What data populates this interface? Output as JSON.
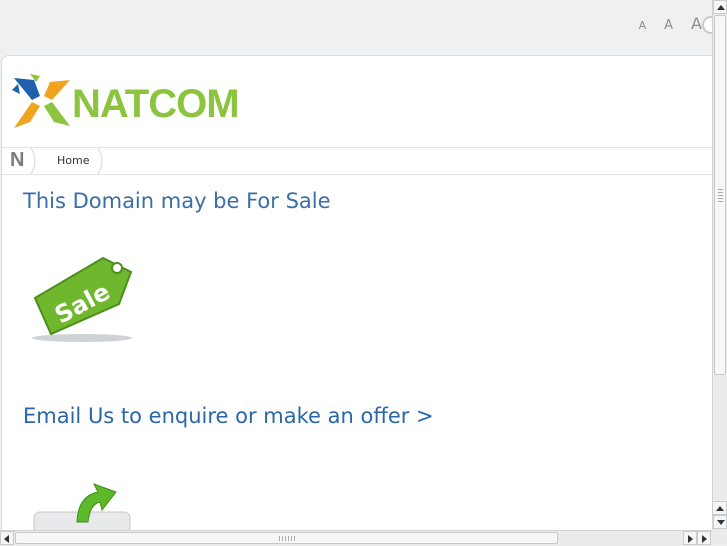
{
  "font_sizer": {
    "small": "A",
    "medium": "A",
    "large": "A"
  },
  "header": {
    "logo_text": "NATCOM"
  },
  "breadcrumb": {
    "root": "N",
    "home": "Home"
  },
  "main": {
    "heading": "This Domain may be For Sale",
    "sale_badge_text": "Sale",
    "offer_link": "Email Us to enquire or make an offer >"
  },
  "colors": {
    "heading": "#3a6ea8",
    "link": "#2a67a8",
    "logo_green": "#8cc43f",
    "logo_orange": "#f0a31f",
    "logo_blue": "#1f5fae"
  },
  "icons": {
    "logo_mark": "natcom-x-logo-icon",
    "sale_tag": "sale-tag-icon",
    "email_forward": "email-forward-icon"
  }
}
